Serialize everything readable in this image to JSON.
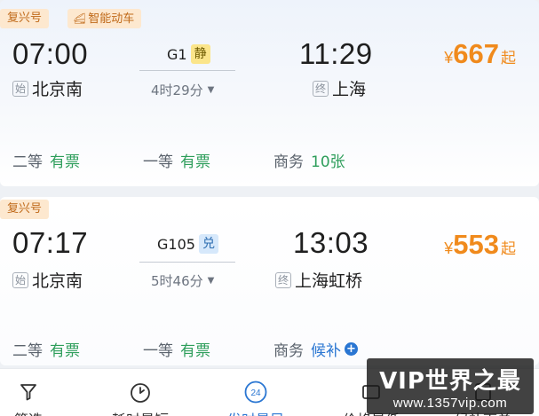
{
  "trains": [
    {
      "train_type": "复兴号",
      "smart_tag": "智能动车",
      "dep_time": "07:00",
      "dep_mark": "始",
      "dep_station": "北京南",
      "train_no": "G1",
      "badge": "静",
      "duration": "4时29分",
      "arr_time": "11:29",
      "arr_mark": "终",
      "arr_station": "上海",
      "price_currency": "¥",
      "price": "667",
      "price_suffix": "起",
      "seats": [
        {
          "class": "二等",
          "status": "有票"
        },
        {
          "class": "一等",
          "status": "有票"
        },
        {
          "class": "商务",
          "status": "10张"
        }
      ]
    },
    {
      "train_type": "复兴号",
      "dep_time": "07:17",
      "dep_mark": "始",
      "dep_station": "北京南",
      "train_no": "G105",
      "badge": "兑",
      "duration": "5时46分",
      "arr_time": "13:03",
      "arr_mark": "终",
      "arr_station": "上海虹桥",
      "price_currency": "¥",
      "price": "553",
      "price_suffix": "起",
      "seats": [
        {
          "class": "二等",
          "status": "有票"
        },
        {
          "class": "一等",
          "status": "有票"
        },
        {
          "class": "商务",
          "status": "候补"
        }
      ]
    }
  ],
  "bottom_bar": {
    "items": [
      {
        "label": "筛选",
        "icon": "filter-icon"
      },
      {
        "label": "耗时最短",
        "icon": "timer-icon"
      },
      {
        "label": "发时最早",
        "icon": "clock-24-icon",
        "icon_text": "24",
        "active": true
      },
      {
        "label": "价格最低",
        "icon": "price-icon"
      },
      {
        "label": "候补下单",
        "icon": "waitlist-icon"
      }
    ]
  },
  "watermark": {
    "title": "VIP世界之最",
    "url": "www.1357vip.com"
  },
  "colors": {
    "price": "#f08a1c",
    "available": "#2e9e5b",
    "accent": "#2a76d2"
  }
}
